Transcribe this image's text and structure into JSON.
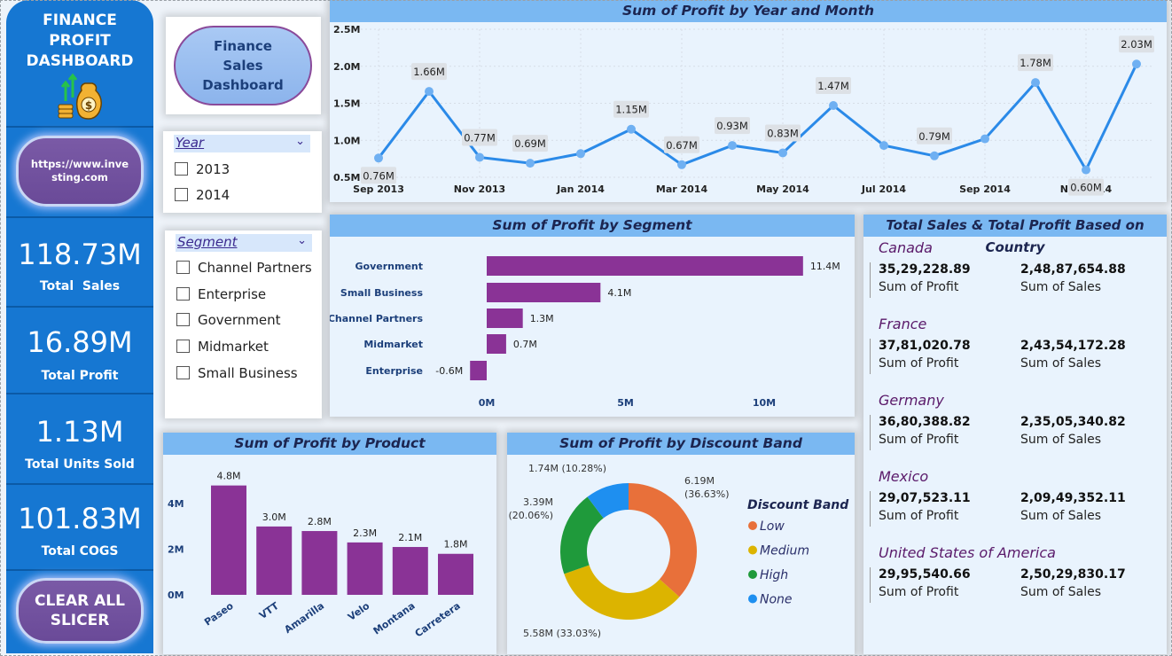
{
  "sidebar": {
    "title": "FINANCE PROFIT DASHBOARD",
    "icon": "money-bag-coins-icon",
    "link_button": "https://www.investing.com",
    "kpis": [
      {
        "value": "118.73M",
        "label": "Total  Sales"
      },
      {
        "value": "16.89M",
        "label": "Total Profit"
      },
      {
        "value": "1.13M",
        "label": "Total Units Sold"
      },
      {
        "value": "101.83M",
        "label": "Total COGS"
      }
    ],
    "clear_button": "CLEAR ALL SLICER"
  },
  "nav_button": "Finance Sales Dashboard",
  "slicers": {
    "year": {
      "title": "Year",
      "options": [
        "2013",
        "2014"
      ]
    },
    "segment": {
      "title": "Segment",
      "options": [
        "Channel Partners",
        "Enterprise",
        "Government",
        "Midmarket",
        "Small Business"
      ]
    }
  },
  "colors": {
    "accent": "#1677d2",
    "bar": "#8a3396",
    "line": "#2b8ae8"
  },
  "line_chart": {
    "title": "Sum of Profit by Year and Month",
    "chart_data": {
      "type": "line",
      "x": [
        "Sep 2013",
        "Oct 2013",
        "Nov 2013",
        "Dec 2013",
        "Jan 2014",
        "Feb 2014",
        "Mar 2014",
        "Apr 2014",
        "May 2014",
        "Jun 2014",
        "Jul 2014",
        "Aug 2014",
        "Sep 2014",
        "Oct 2014",
        "Nov 2014",
        "Dec 2014"
      ],
      "values": [
        0.76,
        1.66,
        0.77,
        0.69,
        0.82,
        1.15,
        0.67,
        0.93,
        0.83,
        1.47,
        0.93,
        0.79,
        1.02,
        1.78,
        0.6,
        2.03
      ],
      "data_labels": [
        "0.76M",
        "1.66M",
        "0.77M",
        "0.69M",
        "",
        "1.15M",
        "0.67M",
        "0.93M",
        "0.83M",
        "1.47M",
        "",
        "0.79M",
        "",
        "1.78M",
        "0.60M",
        "2.03M"
      ],
      "x_ticks": [
        "Sep 2013",
        "Nov 2013",
        "Jan 2014",
        "Mar 2014",
        "May 2014",
        "Jul 2014",
        "Sep 2014",
        "Nov 2014"
      ],
      "y_ticks": [
        "0.5M",
        "1.0M",
        "1.5M",
        "2.0M",
        "2.5M"
      ],
      "ylim": [
        0.5,
        2.5
      ],
      "grid": true
    }
  },
  "segment_chart": {
    "title": "Sum of Profit by Segment",
    "chart_data": {
      "type": "bar",
      "orientation": "horizontal",
      "categories": [
        "Government",
        "Small Business",
        "Channel Partners",
        "Midmarket",
        "Enterprise"
      ],
      "values": [
        11.4,
        4.1,
        1.3,
        0.7,
        -0.6
      ],
      "data_labels": [
        "11.4M",
        "4.1M",
        "1.3M",
        "0.7M",
        "-0.6M"
      ],
      "x_ticks": [
        "0M",
        "5M",
        "10M"
      ],
      "xlim": [
        -0.6,
        12
      ]
    }
  },
  "product_chart": {
    "title": "Sum of Profit by Product",
    "chart_data": {
      "type": "bar",
      "categories": [
        "Paseo",
        "VTT",
        "Amarilla",
        "Velo",
        "Montana",
        "Carretera"
      ],
      "values": [
        4.8,
        3.0,
        2.8,
        2.3,
        2.1,
        1.8
      ],
      "data_labels": [
        "4.8M",
        "3.0M",
        "2.8M",
        "2.3M",
        "2.1M",
        "1.8M"
      ],
      "y_ticks": [
        "0M",
        "2M",
        "4M"
      ],
      "ylim": [
        0,
        5
      ]
    }
  },
  "discount_chart": {
    "title": "Sum of Profit by Discount Band",
    "legend_title": "Discount Band",
    "chart_data": {
      "type": "pie",
      "donut": true,
      "categories": [
        "Low",
        "Medium",
        "High",
        "None"
      ],
      "values": [
        6.19,
        5.58,
        3.39,
        1.74
      ],
      "percent": [
        36.63,
        33.03,
        20.06,
        10.28
      ],
      "colors": [
        "#e8703a",
        "#dcb400",
        "#1f9a3b",
        "#1e8ff0"
      ],
      "labels": [
        [
          "6.19M",
          "(36.63%)"
        ],
        [
          "5.58M (33.03%)"
        ],
        [
          "3.39M",
          "(20.06%)"
        ],
        [
          "1.74M (10.28%)"
        ]
      ]
    }
  },
  "country_card": {
    "title": "Total Sales & Total Profit Based on Country",
    "profit_label": "Sum of Profit",
    "sales_label": "Sum of Sales",
    "countries": [
      {
        "name": "Canada",
        "profit": "35,29,228.89",
        "sales": "2,48,87,654.88"
      },
      {
        "name": "France",
        "profit": "37,81,020.78",
        "sales": "2,43,54,172.28"
      },
      {
        "name": "Germany",
        "profit": "36,80,388.82",
        "sales": "2,35,05,340.82"
      },
      {
        "name": "Mexico",
        "profit": "29,07,523.11",
        "sales": "2,09,49,352.11"
      },
      {
        "name": "United States of America",
        "profit": "29,95,540.66",
        "sales": "2,50,29,830.17"
      }
    ]
  }
}
